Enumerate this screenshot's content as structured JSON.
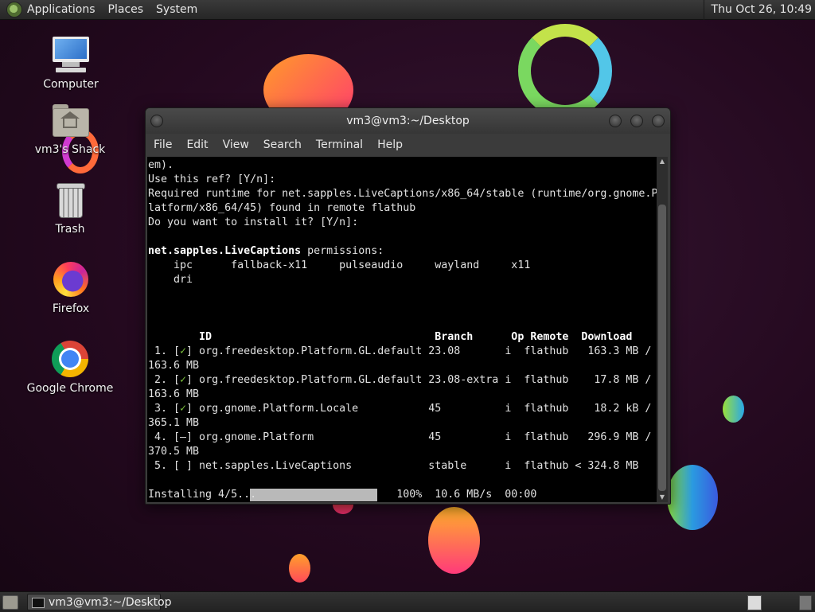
{
  "top_panel": {
    "menus": [
      "Applications",
      "Places",
      "System"
    ],
    "clock": "Thu Oct 26, 10:49"
  },
  "desktop_icons": [
    {
      "label": "Computer",
      "icon": "computer-icon"
    },
    {
      "label": "vm3's Shack",
      "icon": "home-folder-icon"
    },
    {
      "label": "Trash",
      "icon": "trash-icon"
    },
    {
      "label": "Firefox",
      "icon": "firefox-icon"
    },
    {
      "label": "Google Chrome",
      "icon": "chrome-icon"
    }
  ],
  "terminal_window": {
    "title": "vm3@vm3:~/Desktop",
    "menus": [
      "File",
      "Edit",
      "View",
      "Search",
      "Terminal",
      "Help"
    ],
    "lines": [
      "em).",
      "Use this ref? [Y/n]:",
      "Required runtime for net.sapples.LiveCaptions/x86_64/stable (runtime/org.gnome.P",
      "latform/x86_64/45) found in remote flathub",
      "Do you want to install it? [Y/n]:",
      "",
      "net.sapples.LiveCaptions permissions:",
      "    ipc      fallback-x11     pulseaudio     wayland     x11",
      "    dri",
      "",
      "",
      "",
      "        ID                                   Branch      Op Remote  Download",
      " 1. [✓] org.freedesktop.Platform.GL.default 23.08       i  flathub   163.3 MB /",
      "163.6 MB",
      " 2. [✓] org.freedesktop.Platform.GL.default 23.08-extra i  flathub    17.8 MB /",
      "163.6 MB",
      " 3. [✓] org.gnome.Platform.Locale           45          i  flathub    18.2 kB /",
      "365.1 MB",
      " 4. [–] org.gnome.Platform                  45          i  flathub   296.9 MB /",
      "370.5 MB",
      " 5. [ ] net.sapples.LiveCaptions            stable      i  flathub < 324.8 MB",
      "",
      "Installing 4/5...                      100%  10.6 MB/s  00:00"
    ],
    "install_progress_percent": 100
  },
  "bottom_panel": {
    "task_label": "vm3@vm3:~/Desktop"
  }
}
